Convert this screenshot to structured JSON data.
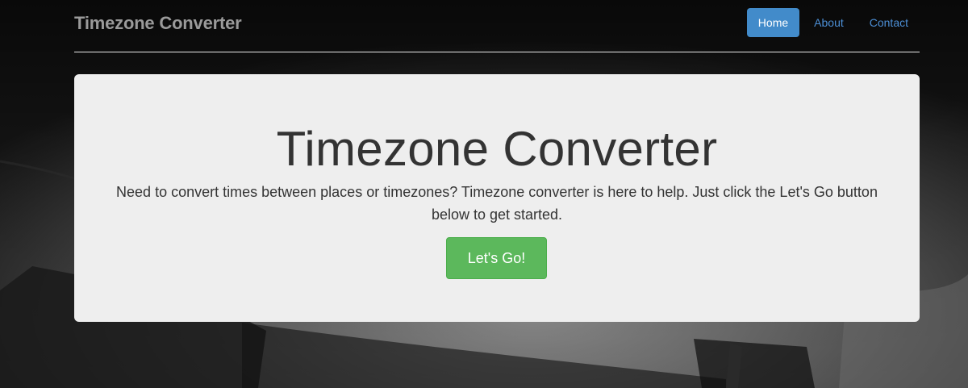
{
  "navbar": {
    "brand": "Timezone Converter",
    "links": [
      {
        "label": "Home",
        "active": true
      },
      {
        "label": "About",
        "active": false
      },
      {
        "label": "Contact",
        "active": false
      }
    ]
  },
  "jumbotron": {
    "title": "Timezone Converter",
    "text": "Need to convert times between places or timezones? Timezone converter is here to help. Just click the Let's Go button below to get started.",
    "button_label": "Let's Go!"
  },
  "colors": {
    "primary": "#428bca",
    "success": "#5cb85c",
    "link": "#4c8fd6",
    "jumbotron_bg": "#eeeeee"
  }
}
